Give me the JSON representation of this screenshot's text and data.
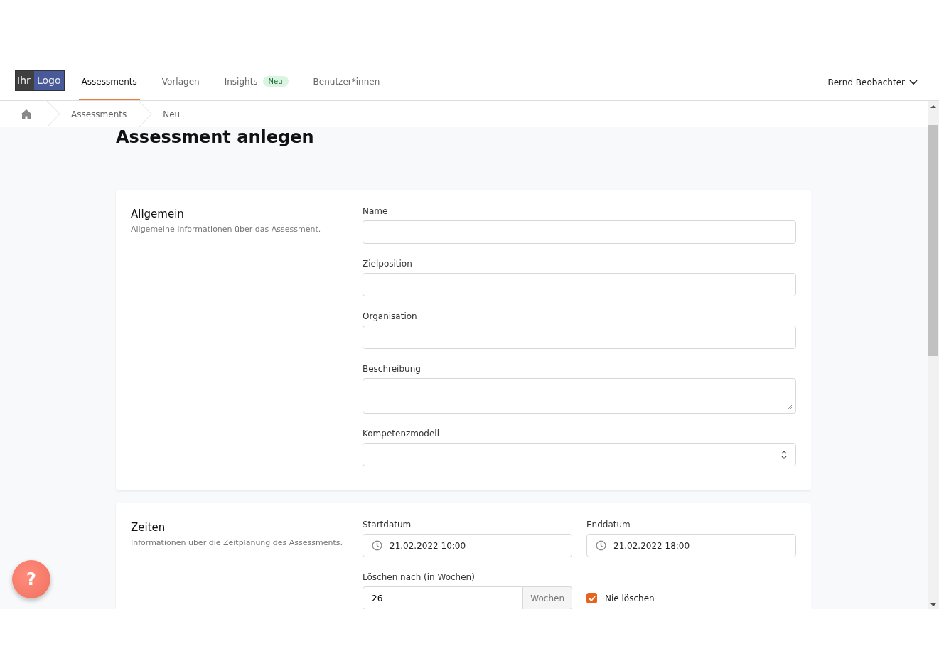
{
  "logo": {
    "parts": [
      "Ihr",
      "Logo"
    ]
  },
  "nav": [
    {
      "label": "Assessments",
      "selected": true
    },
    {
      "label": "Vorlagen",
      "selected": false
    },
    {
      "label": "Insights",
      "selected": false,
      "badge": "Neu"
    },
    {
      "label": "Benutzer*innen",
      "selected": false
    }
  ],
  "user": {
    "name": "Bernd Beobachter"
  },
  "breadcrumb": [
    "Assessments",
    "Neu"
  ],
  "title": "Assessment anlegen",
  "sections": [
    {
      "title": "Allgemein",
      "description": "Allgemeine Informationen über das Assessment.",
      "rows": [
        [
          {
            "kind": "text",
            "label": "Name"
          }
        ],
        [
          {
            "kind": "text",
            "label": "Zielposition"
          }
        ],
        [
          {
            "kind": "text",
            "label": "Organisation"
          }
        ],
        [
          {
            "kind": "textarea",
            "label": "Beschreibung"
          }
        ],
        [
          {
            "kind": "select",
            "label": "Kompetenzmodell"
          }
        ]
      ]
    },
    {
      "title": "Zeiten",
      "description": "Informationen über die Zeitplanung des Assessments.",
      "rows": [
        [
          {
            "kind": "datetime",
            "label": "Startdatum",
            "value": "21.02.2022 10:00"
          },
          {
            "kind": "datetime",
            "label": "Enddatum",
            "value": "21.02.2022 18:00"
          }
        ],
        [
          {
            "kind": "addon",
            "label": "Löschen nach (in Wochen)",
            "value": "26",
            "addon": "Wochen"
          },
          {
            "kind": "checkbox",
            "label": "Nie löschen",
            "checked": true
          }
        ]
      ]
    }
  ],
  "help_button": {
    "label": "?"
  }
}
